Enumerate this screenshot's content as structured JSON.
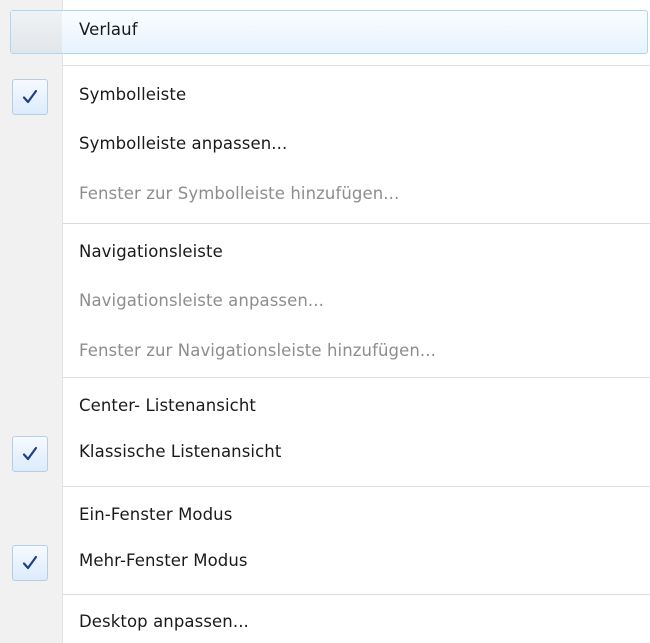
{
  "menu": {
    "items": [
      {
        "label": "Verlauf",
        "checked": false,
        "disabled": false,
        "highlighted": true
      },
      {
        "label": "Symbolleiste",
        "checked": true,
        "disabled": false
      },
      {
        "label": "Symbolleiste anpassen...",
        "checked": false,
        "disabled": false
      },
      {
        "label": "Fenster zur Symbolleiste hinzufügen...",
        "checked": false,
        "disabled": true
      },
      {
        "label": "Navigationsleiste",
        "checked": false,
        "disabled": false
      },
      {
        "label": "Navigationsleiste anpassen...",
        "checked": false,
        "disabled": true
      },
      {
        "label": "Fenster zur Navigationsleiste hinzufügen...",
        "checked": false,
        "disabled": true
      },
      {
        "label": "Center- Listenansicht",
        "checked": false,
        "disabled": false
      },
      {
        "label": "Klassische Listenansicht",
        "checked": true,
        "disabled": false
      },
      {
        "label": "Ein-Fenster Modus",
        "checked": false,
        "disabled": false
      },
      {
        "label": "Mehr-Fenster Modus",
        "checked": true,
        "disabled": false
      },
      {
        "label": "Desktop anpassen...",
        "checked": false,
        "disabled": false
      }
    ]
  },
  "icons": {
    "check": "checkmark-icon"
  },
  "colors": {
    "gutter": "#f1f1f1",
    "checkmark": "#1f3e8c",
    "text": "#1a1a1a",
    "disabled_text": "#8d8d8d",
    "highlight_border": "#a8d8f4",
    "separator": "#dcdcdc"
  }
}
